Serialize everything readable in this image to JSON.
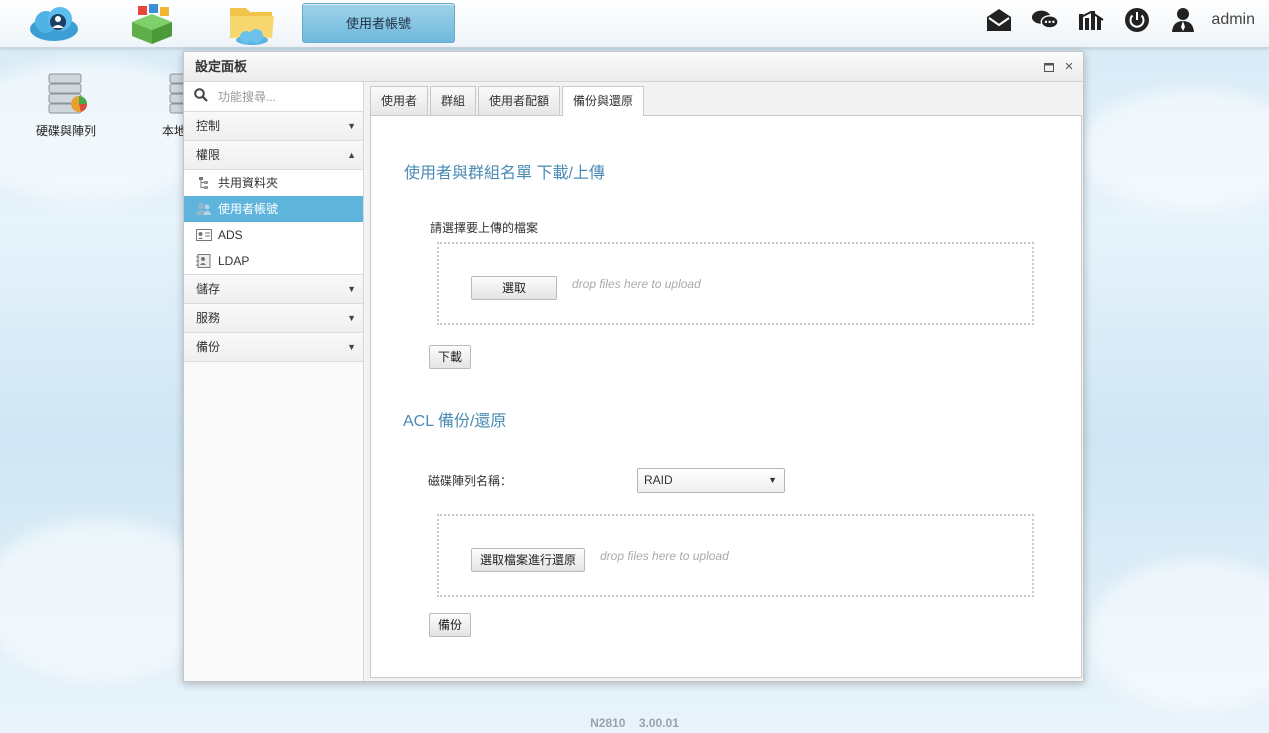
{
  "taskbar": {
    "apps": [
      {
        "icon": "cloud-person-icon"
      },
      {
        "icon": "app-center-icon"
      },
      {
        "icon": "folder-cloud-icon"
      }
    ],
    "active_tab_label": "使用者帳號",
    "right_icons": [
      "mail-icon",
      "chat-icon",
      "network-icon",
      "power-icon",
      "user-icon"
    ],
    "username": "admin"
  },
  "desktop": {
    "icons": [
      {
        "label": "硬碟與陣列",
        "icon": "disk-array-icon"
      },
      {
        "label": "本地",
        "icon": "local-storage-icon"
      }
    ]
  },
  "window": {
    "title": "設定面板",
    "sidebar": {
      "search_placeholder": "功能搜尋...",
      "categories": {
        "control": "控制",
        "permission": "權限",
        "storage": "儲存",
        "service": "服務",
        "backup": "備份"
      },
      "permission_items": {
        "shared_folder": "共用資料夾",
        "user_account": "使用者帳號",
        "ads": "ADS",
        "ldap": "LDAP"
      }
    },
    "tabs": {
      "users": "使用者",
      "groups": "群組",
      "quota": "使用者配額",
      "backup_restore": "備份與還原"
    },
    "section1": {
      "title": "使用者與群組名單 下載/上傳",
      "upload_label": "請選擇要上傳的檔案",
      "choose_button": "選取",
      "drop_hint": "drop files here to upload",
      "download_button": "下載"
    },
    "section2": {
      "title": "ACL 備份/還原",
      "raid_label": "磁碟陣列名稱：",
      "raid_value": "RAID",
      "choose_restore_button": "選取檔案進行還原",
      "drop_hint": "drop files here to upload",
      "backup_button": "備份"
    }
  },
  "footer": {
    "model": "N2810",
    "version": "3.00.01"
  }
}
